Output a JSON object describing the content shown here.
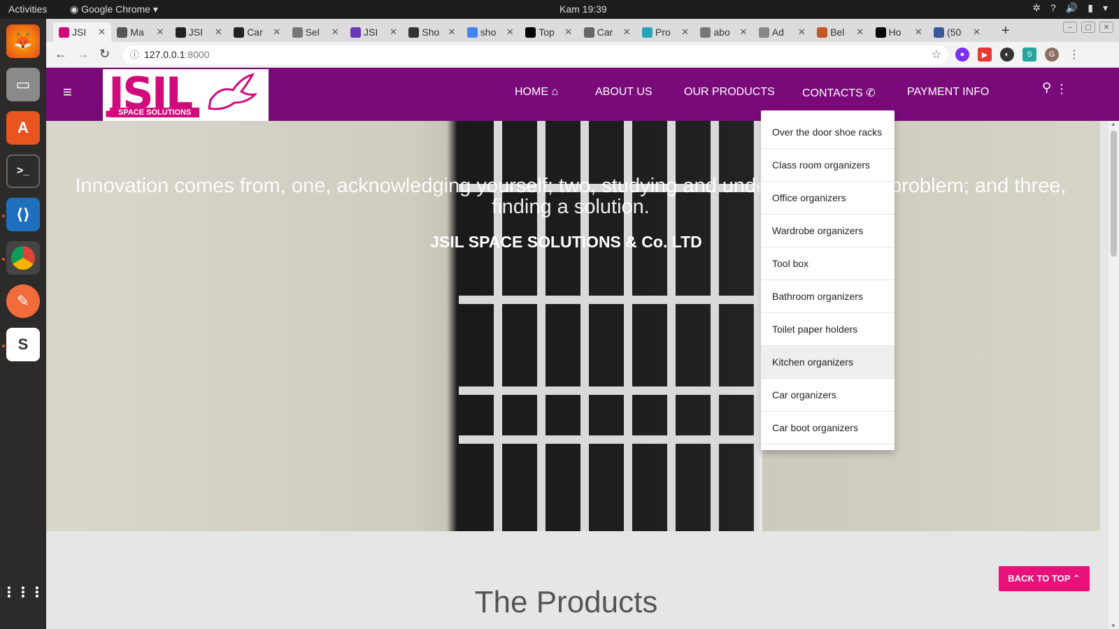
{
  "system": {
    "activities": "Activities",
    "app_name": "Google Chrome",
    "clock": "Kam 19:39"
  },
  "dock": [
    "firefox-icon",
    "files-icon",
    "software-center-icon",
    "terminal-icon",
    "vscode-icon",
    "chrome-icon",
    "postman-icon",
    "slack-icon",
    "app-grid-icon"
  ],
  "browser": {
    "tabs": [
      {
        "label": "JSI",
        "icon": "jsil-favicon",
        "color": "#d10a7c",
        "active": true
      },
      {
        "label": "Ma",
        "icon": "gmail-favicon",
        "color": "#555555"
      },
      {
        "label": "JSI",
        "icon": "github-icon",
        "color": "#222222"
      },
      {
        "label": "Car",
        "icon": "github-icon",
        "color": "#222222"
      },
      {
        "label": "Sel",
        "icon": "doc-icon",
        "color": "#777777"
      },
      {
        "label": "JSI",
        "icon": "forms-icon",
        "color": "#673ab7"
      },
      {
        "label": "Sho",
        "icon": "site-icon",
        "color": "#333333"
      },
      {
        "label": "sho",
        "icon": "google-icon",
        "color": "#4285f4"
      },
      {
        "label": "Top",
        "icon": "medium-icon",
        "color": "#000000"
      },
      {
        "label": "Car",
        "icon": "site-icon",
        "color": "#666666"
      },
      {
        "label": "Pro",
        "icon": "site-icon",
        "color": "#29a3b8"
      },
      {
        "label": "abo",
        "icon": "doc-icon",
        "color": "#777777"
      },
      {
        "label": "Ad",
        "icon": "site-icon",
        "color": "#888888"
      },
      {
        "label": "Bel",
        "icon": "site-icon",
        "color": "#c0582a"
      },
      {
        "label": "Ho",
        "icon": "site-icon",
        "color": "#000000"
      },
      {
        "label": "(50",
        "icon": "facebook-icon",
        "color": "#3b5998"
      }
    ],
    "url_host": "127.0.0.1",
    "url_port": ":8000"
  },
  "site": {
    "colors": {
      "brand": "#7a0a7a",
      "accent": "#e8117a",
      "logo": "#d10a7c"
    },
    "logo_text": "JSIL",
    "logo_sub": "SPACE SOLUTIONS",
    "nav": {
      "home": "HOME",
      "about": "ABOUT US",
      "products": "OUR PRODUCTS",
      "contacts": "CONTACTS",
      "payment": "PAYMENT INFO"
    },
    "hero": {
      "quote": "Innovation comes from, one, acknowledging yourself; two, studying and understanding the problem; and three, finding a solution.",
      "company": "JSIL SPACE SOLUTIONS & Co. LTD"
    },
    "dropdown": [
      "Over the door shoe racks",
      "Class room organizers",
      "Office organizers",
      "Wardrobe organizers",
      "Tool box",
      "Bathroom organizers",
      "Toilet paper holders",
      "Kitchen organizers",
      "Car organizers",
      "Car boot organizers"
    ],
    "dropdown_hover_index": 7,
    "products_heading": "The Products",
    "back_to_top": "BACK TO TOP"
  }
}
